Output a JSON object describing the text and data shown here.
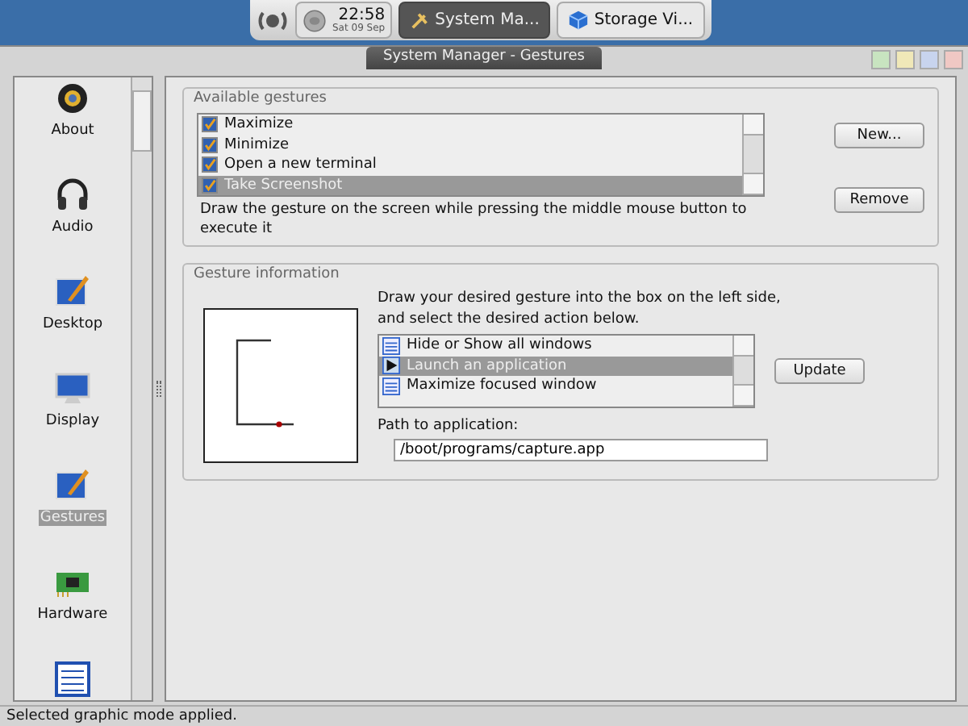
{
  "taskbar": {
    "time": "22:58",
    "date": "Sat 09 Sep",
    "tasks": [
      {
        "label": "System Ma...",
        "selected": true
      },
      {
        "label": "Storage Vi...",
        "selected": false
      }
    ]
  },
  "window": {
    "title": "System Manager - Gestures"
  },
  "sidebar": {
    "items": [
      {
        "label": "About",
        "selected": false
      },
      {
        "label": "Audio",
        "selected": false
      },
      {
        "label": "Desktop",
        "selected": false
      },
      {
        "label": "Display",
        "selected": false
      },
      {
        "label": "Gestures",
        "selected": true
      },
      {
        "label": "Hardware",
        "selected": false
      }
    ]
  },
  "available_gestures": {
    "title": "Available gestures",
    "items": [
      {
        "label": "Maximize",
        "checked": true,
        "selected": false
      },
      {
        "label": "Minimize",
        "checked": true,
        "selected": false
      },
      {
        "label": "Open a new terminal",
        "checked": true,
        "selected": false
      },
      {
        "label": "Take Screenshot",
        "checked": true,
        "selected": true
      }
    ],
    "hint": "Draw the gesture on the screen while pressing the middle mouse button to execute it",
    "buttons": [
      "New...",
      "Remove"
    ]
  },
  "gesture_information": {
    "title": "Gesture information",
    "instructions": [
      "Draw your desired gesture into the box on the left side,",
      "and select the desired action below."
    ],
    "actions": [
      {
        "label": "Hide or Show all windows",
        "selected": false
      },
      {
        "label": "Launch an application",
        "selected": true
      },
      {
        "label": "Maximize focused window",
        "selected": false
      }
    ],
    "update_button": "Update",
    "path_label": "Path to application:",
    "path_value": "/boot/programs/capture.app"
  },
  "status_bar": "Selected graphic mode applied."
}
